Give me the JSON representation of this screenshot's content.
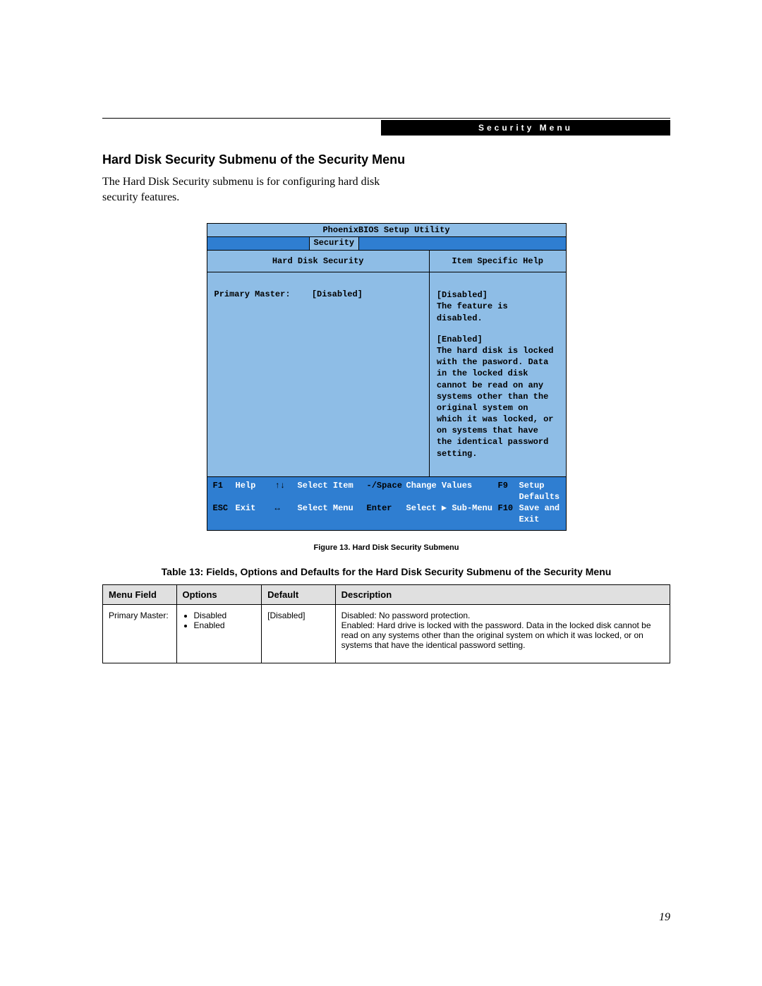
{
  "header": {
    "banner": "Security Menu"
  },
  "section": {
    "title": "Hard Disk Security Submenu of the Security Menu",
    "intro": "The Hard Disk Security submenu is for configuring hard disk security features."
  },
  "bios": {
    "title": "PhoenixBIOS Setup Utility",
    "tab": "Security",
    "left_header": "Hard Disk Security",
    "right_header": "Item Specific Help",
    "field": {
      "label": "Primary Master:",
      "value": "[Disabled]"
    },
    "help": {
      "disabled_head": "[Disabled]",
      "disabled_body": "The feature is disabled.",
      "enabled_head": "[Enabled]",
      "enabled_body": "The hard disk is locked with the pasword. Data in the locked disk cannot be read on any systems other than the original system on which it was locked, or on systems that have the identical password setting."
    },
    "footer": {
      "r1": {
        "k1": "F1",
        "t1": "Help",
        "k2": "↑↓",
        "t2": "Select Item",
        "k3": "-/Space",
        "t3": "Change Values",
        "k4": "F9",
        "t4": "Setup Defaults"
      },
      "r2": {
        "k1": "ESC",
        "t1": "Exit",
        "k2": "↔",
        "t2": "Select Menu",
        "k3": "Enter",
        "t3": "Select ▶ Sub-Menu",
        "k4": "F10",
        "t4": "Save and Exit"
      }
    }
  },
  "figure_caption": "Figure 13.   Hard Disk Security Submenu",
  "table_caption": "Table 13: Fields, Options and Defaults for the Hard Disk Security Submenu of the Security Menu",
  "table": {
    "headers": {
      "c1": "Menu Field",
      "c2": "Options",
      "c3": "Default",
      "c4": "Description"
    },
    "row": {
      "menu_field": "Primary Master:",
      "options": [
        "Disabled",
        "Enabled"
      ],
      "default": "[Disabled]",
      "description": "Disabled: No password protection.\nEnabled: Hard drive is locked with the password. Data in the locked disk cannot be read on any systems other than the original system on which it was locked, or on systems that have the identical password setting."
    }
  },
  "page_number": "19"
}
